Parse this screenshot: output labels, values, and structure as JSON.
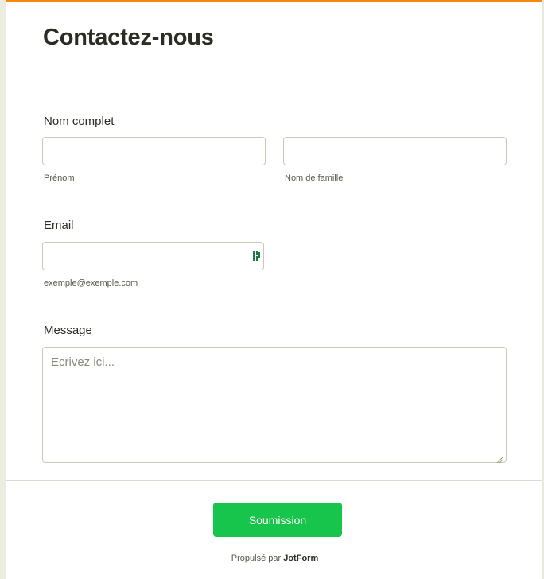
{
  "header": {
    "title": "Contactez-nous"
  },
  "form": {
    "full_name": {
      "label": "Nom complet",
      "first_value": "",
      "last_value": "",
      "first_sublabel": "Prénom",
      "last_sublabel": "Nom de famille"
    },
    "email": {
      "label": "Email",
      "value": "",
      "sublabel": "exemple@exemple.com",
      "icon": "autofill-icon"
    },
    "message": {
      "label": "Message",
      "placeholder": "Ecrivez ici..."
    },
    "submit_label": "Soumission"
  },
  "footer": {
    "powered_prefix": "Propulsé par",
    "brand": "JotForm"
  },
  "colors": {
    "accent_top": "#f5890f",
    "submit": "#18c54c"
  }
}
